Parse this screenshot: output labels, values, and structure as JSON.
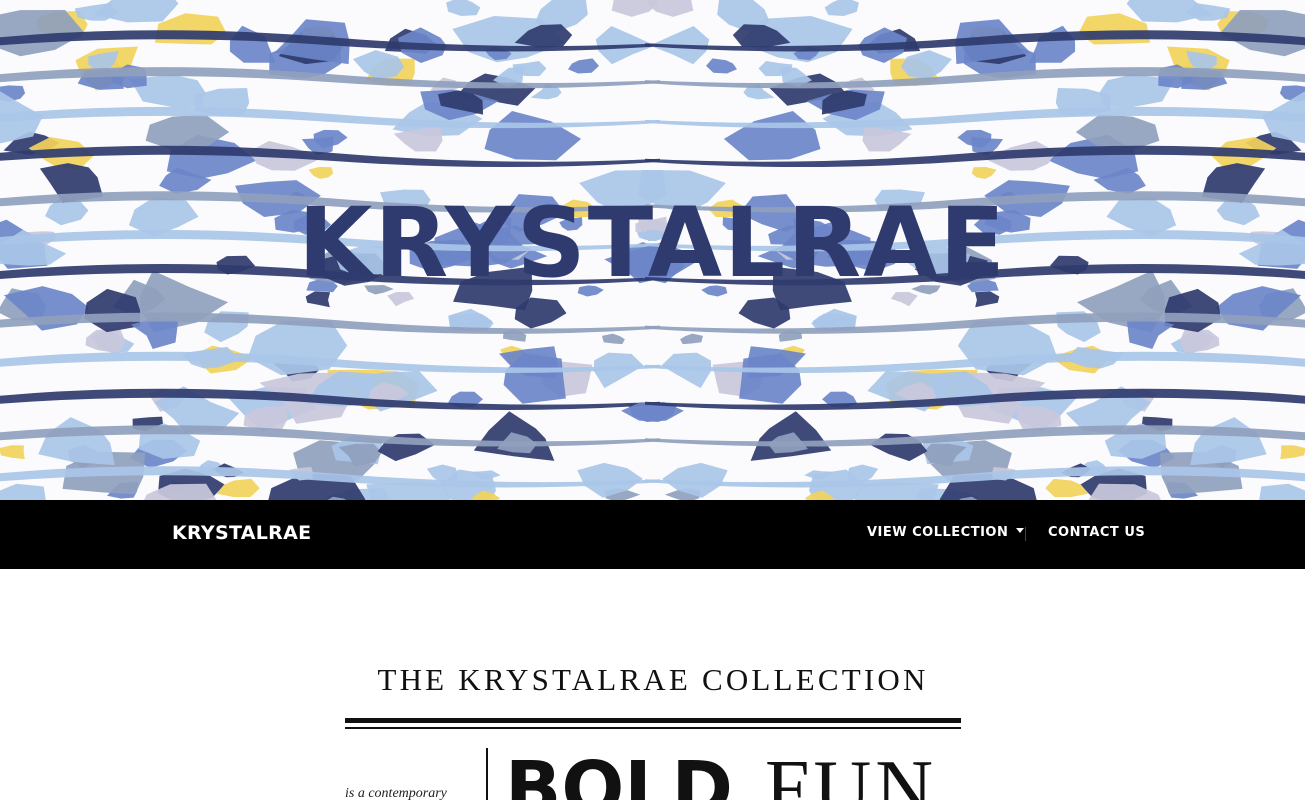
{
  "hero": {
    "title": "KRYSTALRAE",
    "palette": {
      "navy": "#2f3b6e",
      "blue": "#6b86c9",
      "light_blue": "#a9c6e8",
      "slate": "#8f9fbd",
      "lavender": "#c9c8dc",
      "yellow": "#f2d35b",
      "background": "#fbfbfd"
    }
  },
  "navbar": {
    "brand": "KRYSTALRAE",
    "view_collection": "VIEW COLLECTION",
    "contact": "CONTACT US",
    "background": "#000000"
  },
  "collection": {
    "title": "THE KRYSTALRAE COLLECTION",
    "tagline_small": "is a contemporary",
    "word_bold": "BOLD",
    "word_fun": "FUN"
  }
}
